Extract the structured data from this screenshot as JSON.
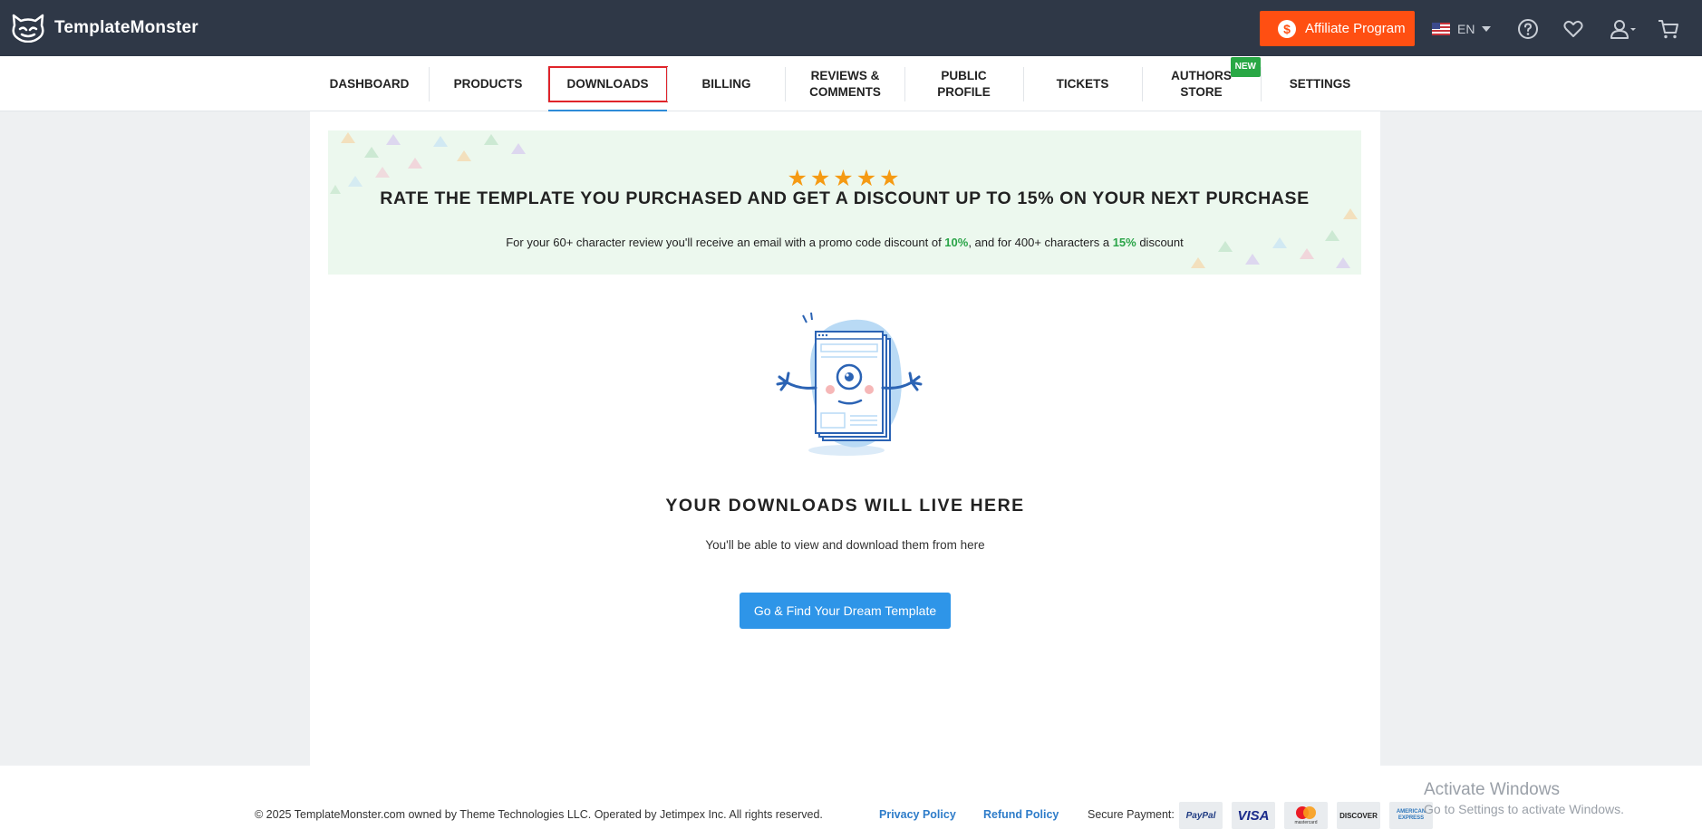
{
  "header": {
    "brand": "TemplateMonster",
    "affiliate_label": "Affiliate Program",
    "affiliate_icon": "dollar-icon",
    "language": "EN",
    "icons": [
      "help-icon",
      "heart-icon",
      "user-icon",
      "cart-icon"
    ]
  },
  "nav": {
    "tabs": [
      {
        "label": "DASHBOARD",
        "active": false
      },
      {
        "label": "PRODUCTS",
        "active": false
      },
      {
        "label": "DOWNLOADS",
        "active": true
      },
      {
        "label": "BILLING",
        "active": false
      },
      {
        "label": "REVIEWS &\nCOMMENTS",
        "active": false
      },
      {
        "label": "PUBLIC\nPROFILE",
        "active": false
      },
      {
        "label": "TICKETS",
        "active": false
      },
      {
        "label": "AUTHORS\nSTORE",
        "active": false,
        "badge": "NEW"
      },
      {
        "label": "SETTINGS",
        "active": false
      }
    ]
  },
  "promo": {
    "stars": "★★★★★",
    "title": "RATE THE TEMPLATE YOU PURCHASED AND GET A DISCOUNT UP TO 15% ON YOUR NEXT PURCHASE",
    "desc_1": "For your 60+ character review you'll receive an email with a promo code discount of ",
    "desc_pct1": "10%",
    "desc_2": ", and for 400+ characters a ",
    "desc_pct2": "15%",
    "desc_3": " discount"
  },
  "empty": {
    "title": "YOUR DOWNLOADS WILL LIVE HERE",
    "subtitle": "You'll be able to view and download them from here",
    "cta": "Go & Find Your Dream Template"
  },
  "footer": {
    "copyright": "© 2025 TemplateMonster.com owned by Theme Technologies LLC. Operated by Jetimpex Inc. All rights reserved.",
    "privacy": "Privacy Policy",
    "refund": "Refund Policy",
    "secure_payment": "Secure Payment:",
    "payment_methods": [
      "PayPal",
      "VISA",
      "mastercard",
      "DISCOVER",
      "AMERICAN EXPRESS"
    ]
  },
  "watermark": {
    "title": "Activate Windows",
    "subtitle": "Go to Settings to activate Windows."
  },
  "colors": {
    "topbar": "#2f3847",
    "accent_orange": "#ff4f12",
    "active_tab_underline": "#2e8bd8",
    "active_tab_highlight": "#e0242a",
    "cta_blue": "#2e95e8",
    "discount_green": "#2aa448"
  }
}
